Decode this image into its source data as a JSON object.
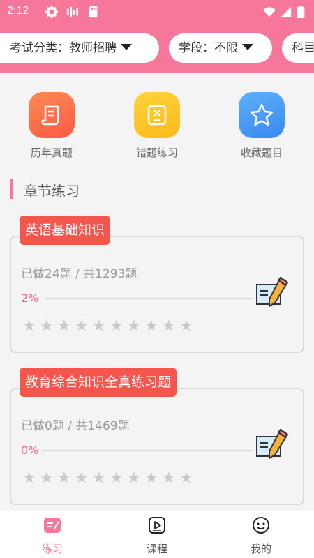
{
  "status_bar": {
    "time": "2:12"
  },
  "filters": [
    {
      "label": "考试分类：教师招聘"
    },
    {
      "label": "学段：不限"
    },
    {
      "label": "科目"
    }
  ],
  "quick_links": [
    {
      "label": "历年真题",
      "icon": "document-icon",
      "color": "#fb6a47"
    },
    {
      "label": "错题练习",
      "icon": "error-box-icon",
      "color": "#fec626"
    },
    {
      "label": "收藏题目",
      "icon": "star-icon",
      "color": "#4a9bf7"
    }
  ],
  "section": {
    "title": "章节练习"
  },
  "chapters": [
    {
      "title": "英语基础知识",
      "done": "已做24题 / 共1293题",
      "percent_label": "2%",
      "progress": 0.02,
      "stars": 0
    },
    {
      "title": "教育综合知识全真练习题",
      "done": "已做0题 / 共1469题",
      "percent_label": "0%",
      "progress": 0,
      "stars": 0
    }
  ],
  "bottom_nav": [
    {
      "label": "练习",
      "icon": "practice-icon",
      "active": true
    },
    {
      "label": "课程",
      "icon": "video-course-icon",
      "active": false
    },
    {
      "label": "我的",
      "icon": "smiley-profile-icon",
      "active": false
    }
  ],
  "colors": {
    "brand_pink": "#f7779a",
    "tag_red": "#f4564d"
  }
}
